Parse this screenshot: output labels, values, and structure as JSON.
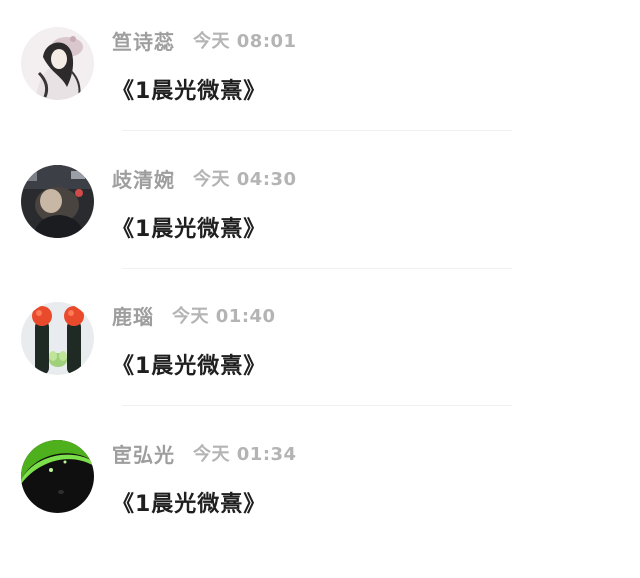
{
  "comments": [
    {
      "user": "笪诗蕊",
      "time": "今天 08:01",
      "text": "《1晨光微熹》",
      "avatar_icon": "anime-girl-avatar-icon"
    },
    {
      "user": "歧清婉",
      "time": "今天 04:30",
      "text": "《1晨光微熹》",
      "avatar_icon": "photo-avatar-icon"
    },
    {
      "user": "鹿瑙",
      "time": "今天 01:40",
      "text": "《1晨光微熹》",
      "avatar_icon": "cactus-avatar-icon"
    },
    {
      "user": "宦弘光",
      "time": "今天 01:34",
      "text": "《1晨光微熹》",
      "avatar_icon": "green-leaf-avatar-icon"
    }
  ],
  "colors": {
    "username": "#9e9e9e",
    "timestamp": "#b4b4b4",
    "comment_text": "#1f1f1f",
    "divider": "#f1f1f1"
  }
}
